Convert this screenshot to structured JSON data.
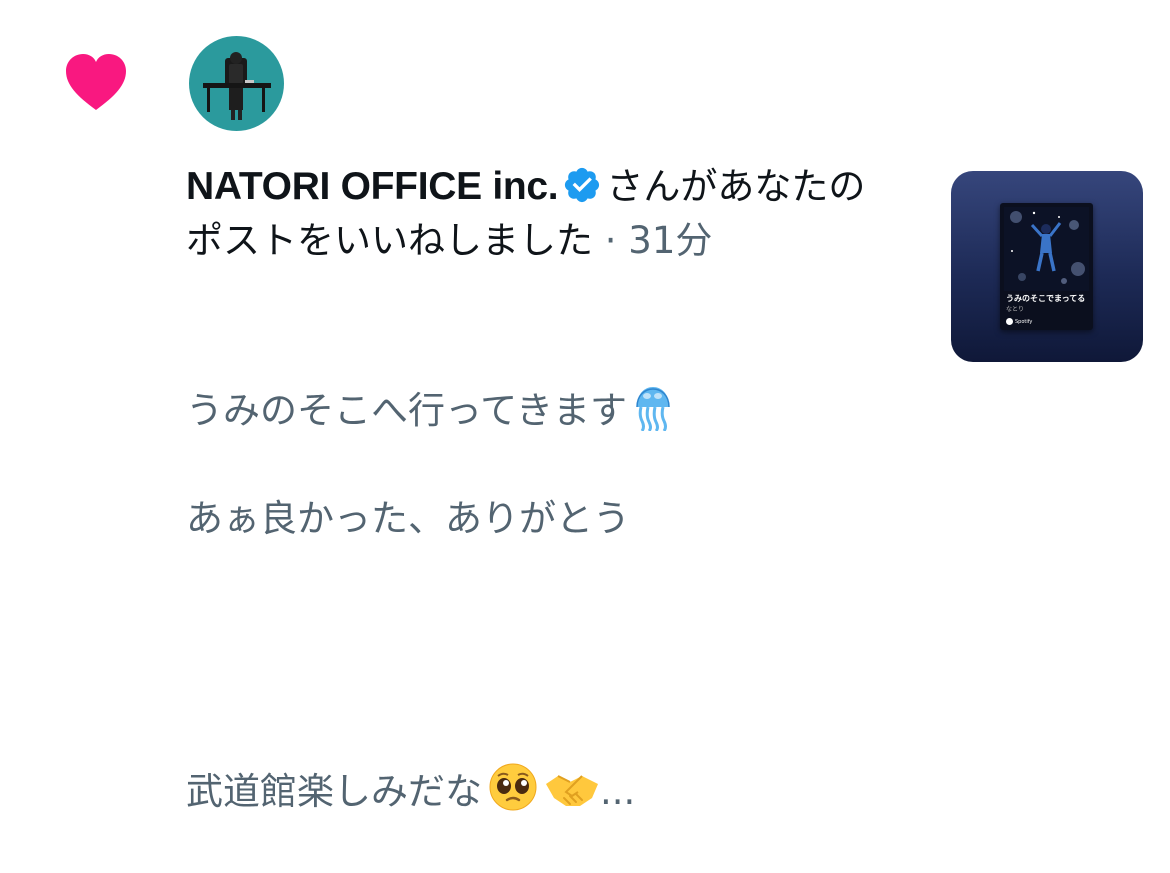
{
  "notification": {
    "type_icon": "heart-icon",
    "author": {
      "name": "NATORI OFFICE inc.",
      "avatar": "avatar-image",
      "verified_icon": "verified-badge-icon"
    },
    "action_text": "さんがあなたのポストをいいねしました",
    "separator": "·",
    "timestamp": "31分",
    "post_lines": {
      "line1": "うみのそこへ行ってきます",
      "line2": "あぁ良かった、ありがとう",
      "line3": "武道館楽しみだな",
      "ellipsis": "..."
    },
    "emoji": {
      "jellyfish": "jellyfish-emoji",
      "pleading": "pleading-face-emoji",
      "handshake": "handshake-emoji"
    },
    "thumbnail": {
      "song_title": "うみのそこでまってる",
      "artist": "なとり",
      "brand": "Spotify"
    }
  },
  "colors": {
    "heart": "#f91880",
    "verified": "#1d9bf0",
    "primary_text": "#0f1419",
    "secondary_text": "#536471",
    "avatar_bg": "#2b9a9d",
    "thumb_bg": "#253463"
  }
}
